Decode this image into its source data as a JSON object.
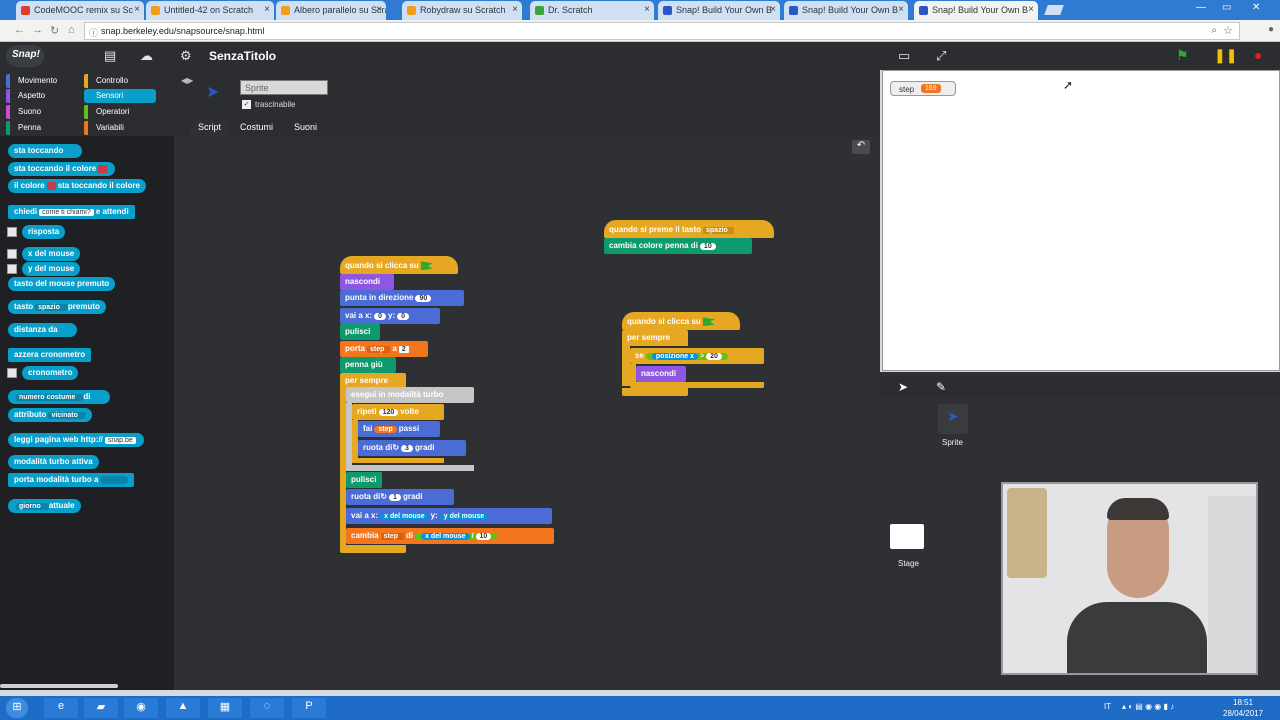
{
  "browser": {
    "tabs": [
      {
        "title": "CodeMOOC remix su Sc",
        "color": "#e03b2b"
      },
      {
        "title": "Untitled-42 on Scratch",
        "color": "#f29b1d"
      },
      {
        "title": "Albero parallelo su Scra",
        "color": "#f29b1d"
      },
      {
        "title": "Robydraw su Scratch",
        "color": "#f29b1d"
      },
      {
        "title": "Dr. Scratch",
        "color": "#3aa63a"
      },
      {
        "title": "Snap! Build Your Own B",
        "color": "#2a56c6"
      },
      {
        "title": "Snap! Build Your Own B",
        "color": "#2a56c6"
      },
      {
        "title": "Snap! Build Your Own B",
        "color": "#2a56c6"
      }
    ],
    "url": "snap.berkeley.edu/snapsource/snap.html"
  },
  "snap": {
    "logo": "Snap!",
    "project_title": "SenzaTitolo"
  },
  "categories": [
    {
      "label": "Movimento",
      "color": "#4a6cd4"
    },
    {
      "label": "Controllo",
      "color": "#e6a822"
    },
    {
      "label": "Aspetto",
      "color": "#8f56e3"
    },
    {
      "label": "Sensori",
      "color": "#089fcb"
    },
    {
      "label": "Suono",
      "color": "#cf4ad9"
    },
    {
      "label": "Operatori",
      "color": "#62c213"
    },
    {
      "label": "Penna",
      "color": "#0e9a6c"
    },
    {
      "label": "Variabili",
      "color": "#f3761d"
    }
  ],
  "palette": {
    "touching": "sta toccando",
    "touching_color": "sta toccando il colore",
    "color_touching_a": "il colore",
    "color_touching_b": "sta toccando il colore",
    "ask": "chiedi",
    "ask_default": "come ti chiami?",
    "ask_wait": "e attendi",
    "answer": "risposta",
    "mouse_x": "x del mouse",
    "mouse_y": "y del mouse",
    "key_pressed": "tasto del mouse premuto",
    "key_a": "tasto",
    "key_space": "spazio",
    "key_b": "premuto",
    "distance": "distanza da",
    "reset_timer": "azzera cronometro",
    "timer": "cronometro",
    "attr_a": "numero costume",
    "attr_of": "di",
    "attribute": "attributo",
    "attribute_dd": "vicinato",
    "url_a": "leggi pagina web http://",
    "url_default": "snap.be",
    "turbo": "modalità turbo attiva",
    "set_turbo": "porta modalità turbo a",
    "date_a": "giorno",
    "date_b": "attuale"
  },
  "sprite": {
    "name": "Sprite",
    "draggable": "trascinabile",
    "tabs": [
      "Script",
      "Costumi",
      "Suoni"
    ]
  },
  "scripts": {
    "s1": {
      "hat": "quando si preme il tasto",
      "hat_key": "spazio",
      "change_pen": "cambia colore penna di",
      "change_pen_val": "10"
    },
    "s2": {
      "hat": "quando si clicca su",
      "forever": "per sempre",
      "if": "se",
      "position": "posizione",
      "axis": "x",
      "op": ">",
      "threshold": "20",
      "hide": "nascondi"
    },
    "s3": {
      "hat": "quando si clicca su",
      "hide": "nascondi",
      "point": "punta in direzione",
      "point_val": "90",
      "goto_a": "vai a x:",
      "goto_x": "0",
      "goto_b": "y:",
      "goto_y": "0",
      "clear": "pulisci",
      "set_a": "porta",
      "set_var": "step",
      "set_b": "a",
      "set_val": "2",
      "pen_down": "penna giù",
      "forever": "per sempre",
      "turbo": "esegui in modalità turbo",
      "repeat_a": "ripeti",
      "repeat_val": "120",
      "repeat_b": "volte",
      "move_a": "fai",
      "move_var": "step",
      "move_b": "passi",
      "turn_a": "ruota di",
      "turn_val": "3",
      "turn_b": "gradi",
      "clear2": "pulisci",
      "turn2_a": "ruota di",
      "turn2_val": "1",
      "turn2_b": "gradi",
      "goto2_a": "vai a x:",
      "goto2_mx": "x del mouse",
      "goto2_b": "y:",
      "goto2_my": "y del mouse",
      "change_a": "cambia",
      "change_var": "step",
      "change_b": "di",
      "change_mx": "x del mouse",
      "change_div": "/",
      "change_val": "10"
    }
  },
  "stage": {
    "watcher_label": "step",
    "watcher_value": "169"
  },
  "corral": {
    "sprite_label": "Sprite",
    "stage_label": "Stage"
  },
  "taskbar": {
    "lang": "IT",
    "time": "18:51",
    "date": "28/04/2017"
  }
}
